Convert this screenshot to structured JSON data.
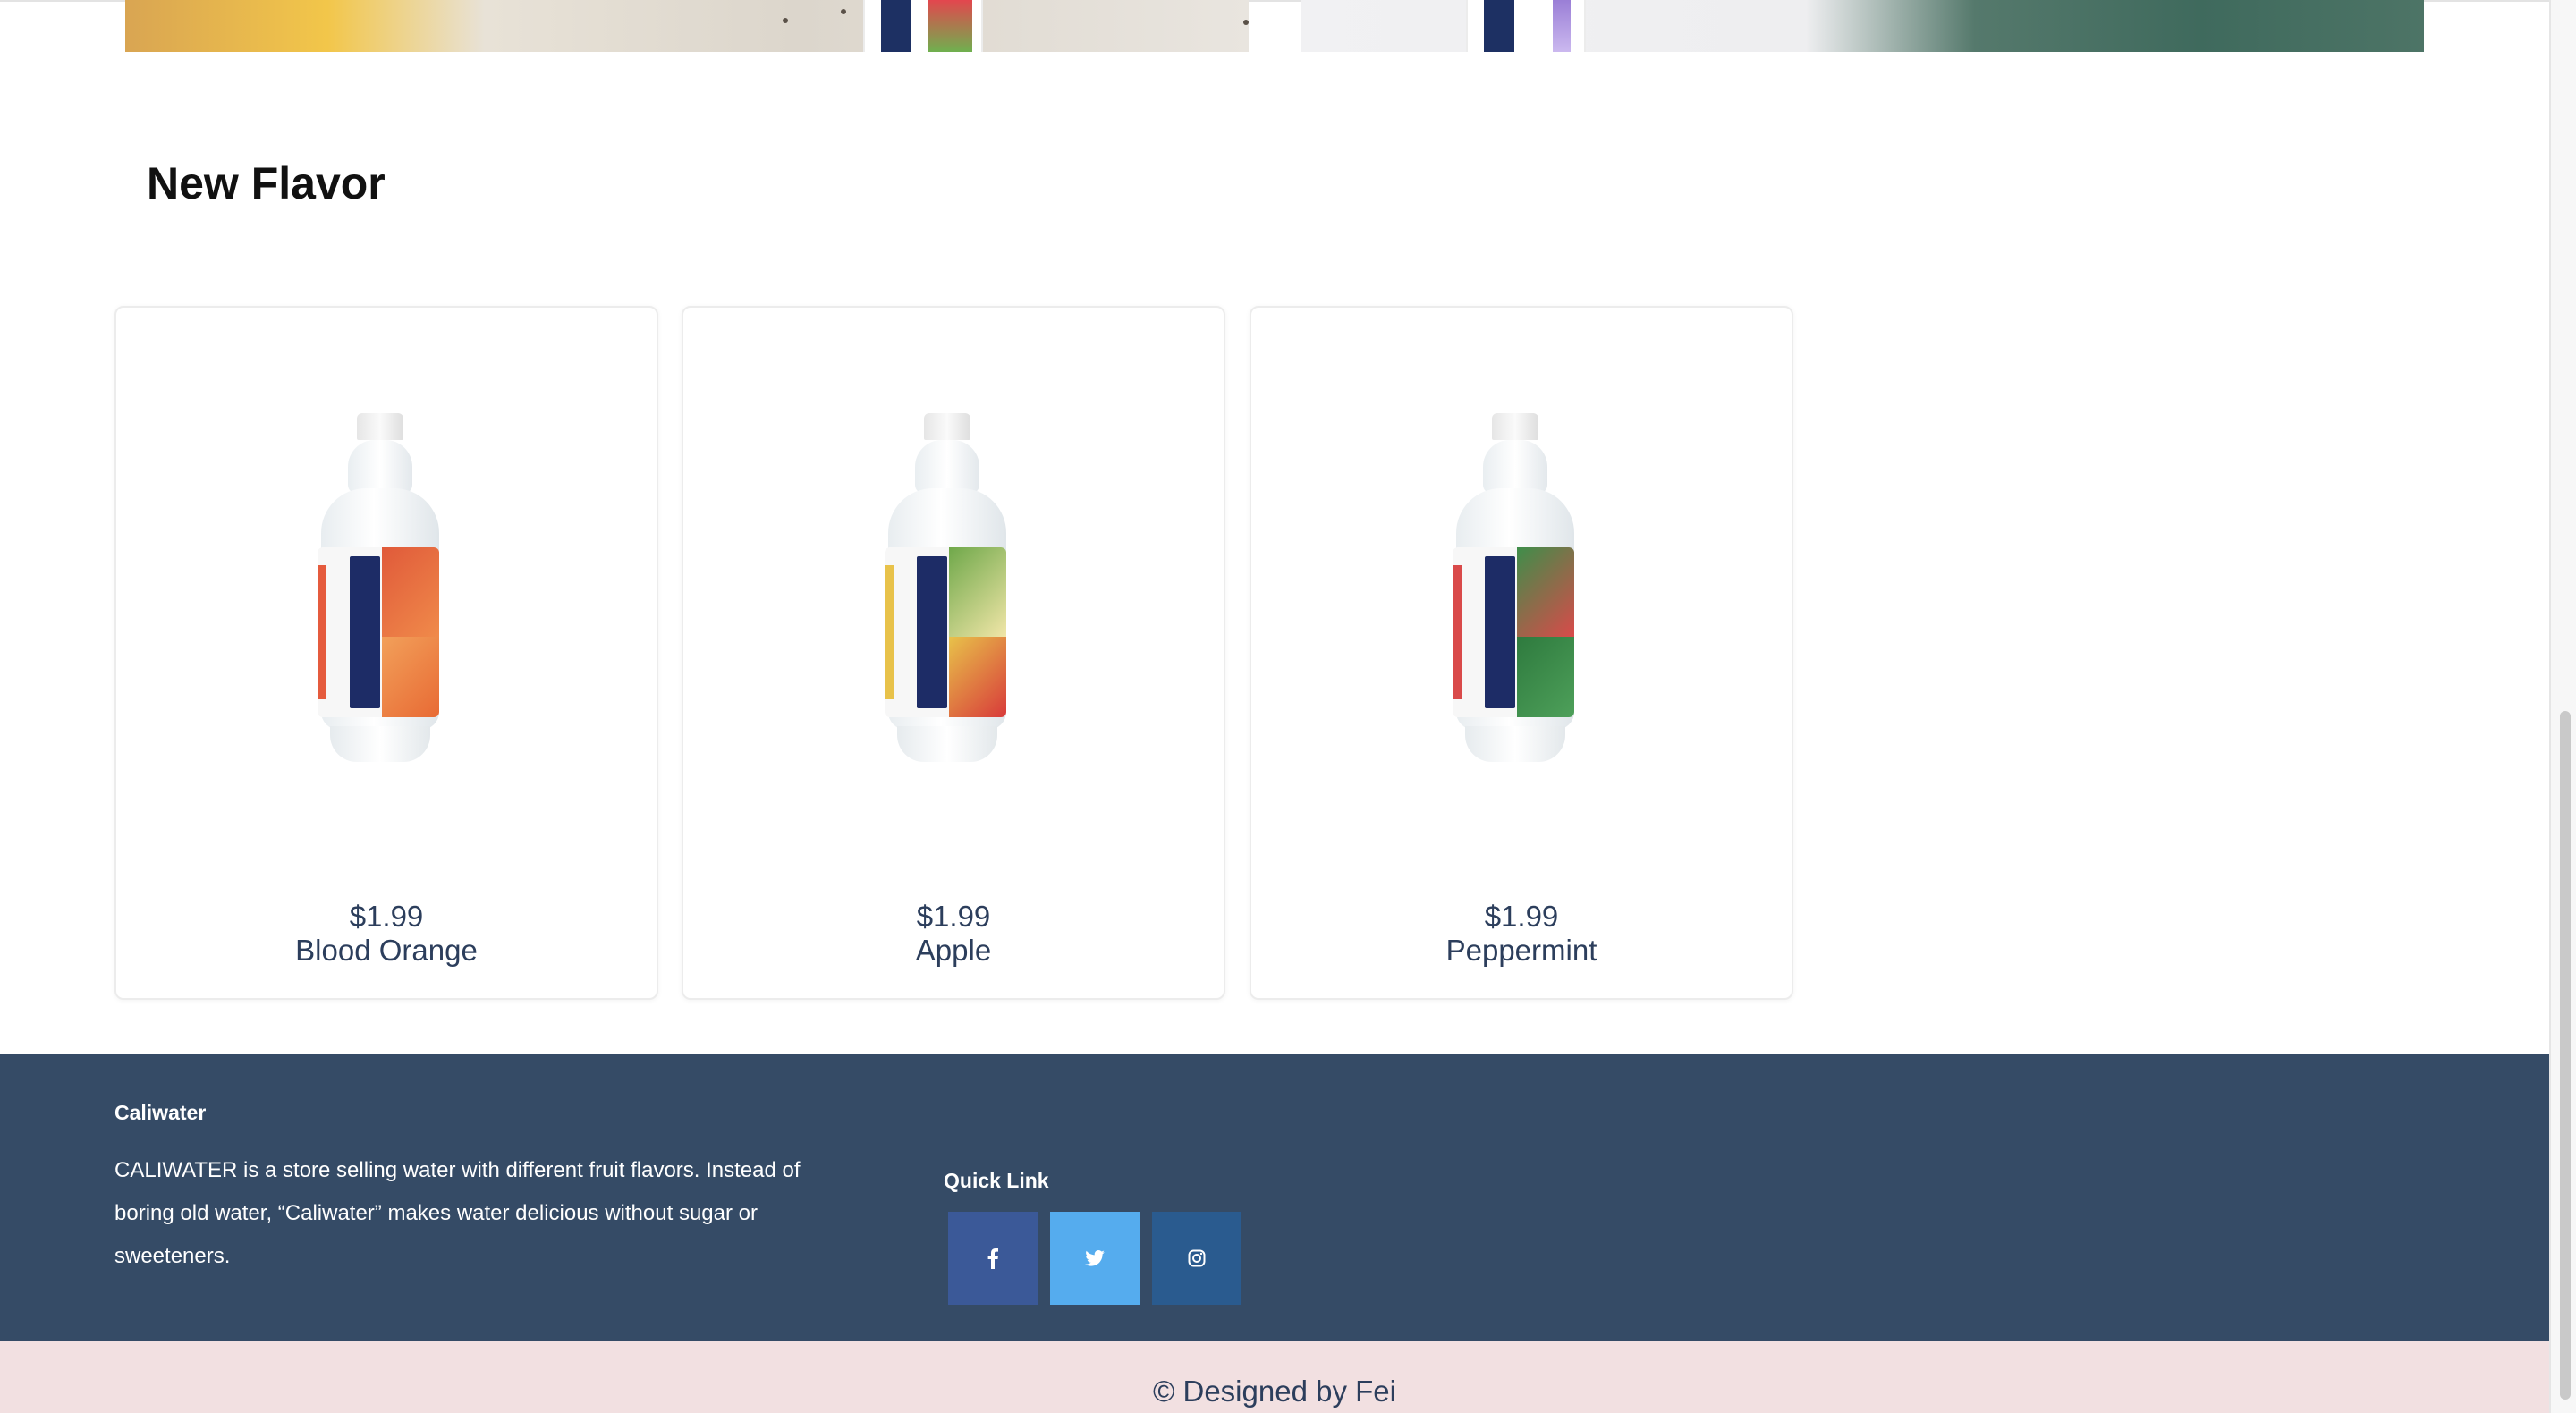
{
  "section": {
    "title": "New Flavor"
  },
  "products": [
    {
      "price": "$1.99",
      "name": "Blood Orange"
    },
    {
      "price": "$1.99",
      "name": "Apple"
    },
    {
      "price": "$1.99",
      "name": "Peppermint"
    }
  ],
  "footer": {
    "brand": "Caliwater",
    "description": "CALIWATER is a store selling water with different fruit flavors. Instead of boring old water, “Caliwater” makes water delicious without sugar or sweeteners.",
    "quick_link_title": "Quick Link",
    "social": [
      {
        "icon": "facebook-icon",
        "color": "#3b5998"
      },
      {
        "icon": "twitter-icon",
        "color": "#55acee"
      },
      {
        "icon": "instagram-icon",
        "color": "#2a5b8f"
      }
    ],
    "copyright": "© Designed by Fei"
  },
  "colors": {
    "footer_bg": "#354b66",
    "copyright_bg": "#f2e0e1",
    "text_dark": "#2c3e5c"
  }
}
